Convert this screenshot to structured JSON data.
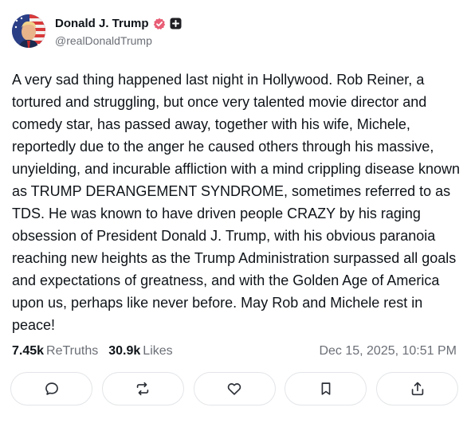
{
  "author": {
    "display_name": "Donald J. Trump",
    "handle": "@realDonaldTrump",
    "avatar_icon": "avatar-photo",
    "verified_icon": "verified-check-icon",
    "plus_icon": "plus-badge-icon"
  },
  "post": {
    "text": "A very sad thing happened last night in Hollywood. Rob Reiner, a tortured and struggling, but once very talented movie director and comedy star, has passed away, together with his wife, Michele, reportedly due to the anger he caused others through his massive, unyielding, and incurable affliction with a mind crippling disease known as TRUMP DERANGEMENT SYNDROME, sometimes referred to as TDS. He was known to have driven people CRAZY by his raging obsession of President Donald J. Trump, with his obvious paranoia reaching new heights as the Trump Administration surpassed all goals and expectations of greatness, and with the Golden Age of America upon us, perhaps like never before. May Rob and Michele rest in peace!"
  },
  "stats": {
    "retruths_count": "7.45k",
    "retruths_label": "ReTruths",
    "likes_count": "30.9k",
    "likes_label": "Likes",
    "timestamp": "Dec 15, 2025, 10:51 PM"
  },
  "actions": [
    {
      "icon": "reply-icon"
    },
    {
      "icon": "retruth-icon"
    },
    {
      "icon": "like-icon"
    },
    {
      "icon": "bookmark-icon"
    },
    {
      "icon": "share-icon"
    }
  ],
  "colors": {
    "text": "#0f1419",
    "muted": "#6b6f76",
    "verified_badge": "#e85d75",
    "button_border": "#e3e5e8"
  }
}
